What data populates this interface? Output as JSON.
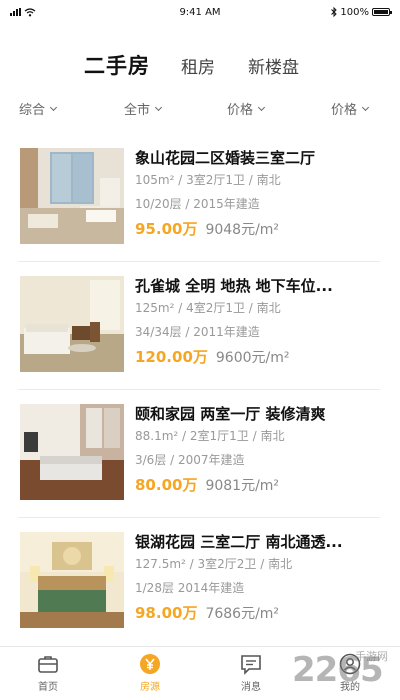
{
  "status_bar": {
    "time": "9:41 AM",
    "battery": "100%"
  },
  "tabs": [
    {
      "label": "二手房",
      "active": true
    },
    {
      "label": "租房",
      "active": false
    },
    {
      "label": "新楼盘",
      "active": false
    }
  ],
  "filters": [
    {
      "label": "综合"
    },
    {
      "label": "全市"
    },
    {
      "label": "价格"
    },
    {
      "label": "价格"
    }
  ],
  "listings": [
    {
      "title": "象山花园二区婚装三室二厅",
      "specs": "105m² / 3室2厅1卫 / 南北",
      "floor": "10/20层 / 2015年建造",
      "price": "95.00万",
      "unit_price": "9048元/m²"
    },
    {
      "title": "孔雀城 全明 地热 地下车位...",
      "specs": "125m² / 4室2厅1卫 / 南北",
      "floor": "34/34层 / 2011年建造",
      "price": "120.00万",
      "unit_price": "9600元/m²"
    },
    {
      "title": "颐和家园 两室一厅 装修清爽",
      "specs": "88.1m² / 2室1厅1卫 / 南北",
      "floor": "3/6层 / 2007年建造",
      "price": "80.00万",
      "unit_price": "9081元/m²"
    },
    {
      "title": "银湖花园 三室二厅 南北通透...",
      "specs": "127.5m² / 3室2厅2卫 / 南北",
      "floor": "1/28层 2014年建造",
      "price": "98.00万",
      "unit_price": "7686元/m²"
    }
  ],
  "bottom_nav": [
    {
      "label": "首页",
      "icon": "briefcase-icon",
      "active": false
    },
    {
      "label": "房源",
      "icon": "yen-icon",
      "active": true
    },
    {
      "label": "消息",
      "icon": "message-icon",
      "active": false
    },
    {
      "label": "我的",
      "icon": "profile-icon",
      "active": false
    }
  ],
  "watermark": {
    "number": "2265",
    "text": "手游网"
  },
  "colors": {
    "accent": "#f5a623",
    "text": "#111111",
    "muted": "#999999"
  }
}
